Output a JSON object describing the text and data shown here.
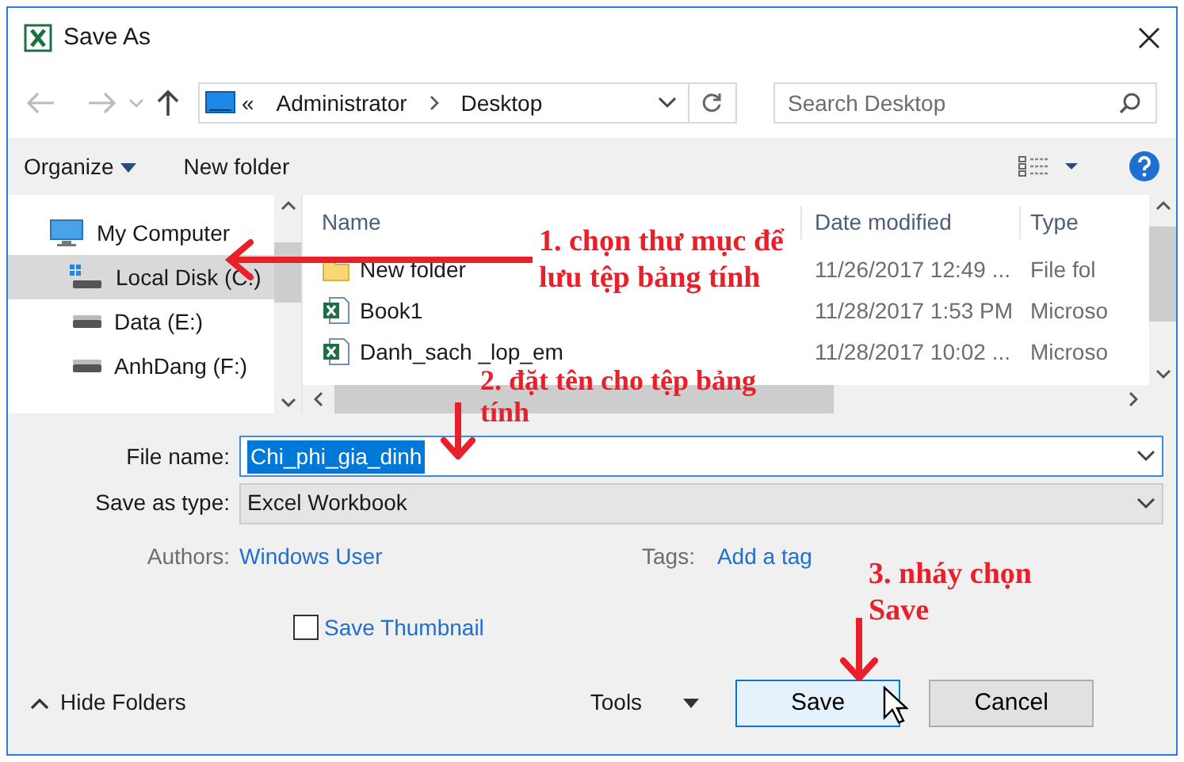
{
  "window": {
    "title": "Save As"
  },
  "address": {
    "prefix": "«",
    "path": [
      "Administrator",
      "Desktop"
    ]
  },
  "search": {
    "placeholder": "Search Desktop"
  },
  "toolbar": {
    "organize": "Organize",
    "new_folder": "New folder"
  },
  "nav": {
    "items": [
      {
        "label": "My Computer",
        "kind": "computer",
        "selected": false,
        "children": [
          {
            "label": "Local Disk (C:)",
            "kind": "system-drive",
            "selected": true
          },
          {
            "label": "Data (E:)",
            "kind": "drive",
            "selected": false
          },
          {
            "label": "AnhDang (F:)",
            "kind": "drive",
            "selected": false
          }
        ]
      }
    ]
  },
  "files": {
    "columns": [
      "Name",
      "Date modified",
      "Type"
    ],
    "rows": [
      {
        "name": "New folder",
        "kind": "folder",
        "date": "11/26/2017 12:49 ...",
        "type": "File fol"
      },
      {
        "name": "Book1",
        "kind": "workbook",
        "date": "11/28/2017 1:53 PM",
        "type": "Microso"
      },
      {
        "name": "Danh_sach _lop_em",
        "kind": "workbook",
        "date": "11/28/2017 10:02 ...",
        "type": "Microso"
      }
    ]
  },
  "form": {
    "file_name": {
      "label": "File name:",
      "value": "Chi_phi_gia_dinh"
    },
    "save_type": {
      "label": "Save as type:",
      "value": "Excel Workbook"
    },
    "authors": {
      "label": "Authors:",
      "value": "Windows User"
    },
    "tags": {
      "label": "Tags:",
      "value": "Add a tag"
    },
    "thumbnail": {
      "label": "Save Thumbnail",
      "checked": false
    }
  },
  "footer": {
    "hide_folders": "Hide Folders",
    "tools": "Tools",
    "save": "Save",
    "cancel": "Cancel"
  },
  "annotations": [
    {
      "text": "1. chọn thư mục để lưu tệp bảng tính"
    },
    {
      "text": "2. đặt tên cho tệp bảng tính"
    },
    {
      "text": "3. nháy chọn Save"
    }
  ]
}
